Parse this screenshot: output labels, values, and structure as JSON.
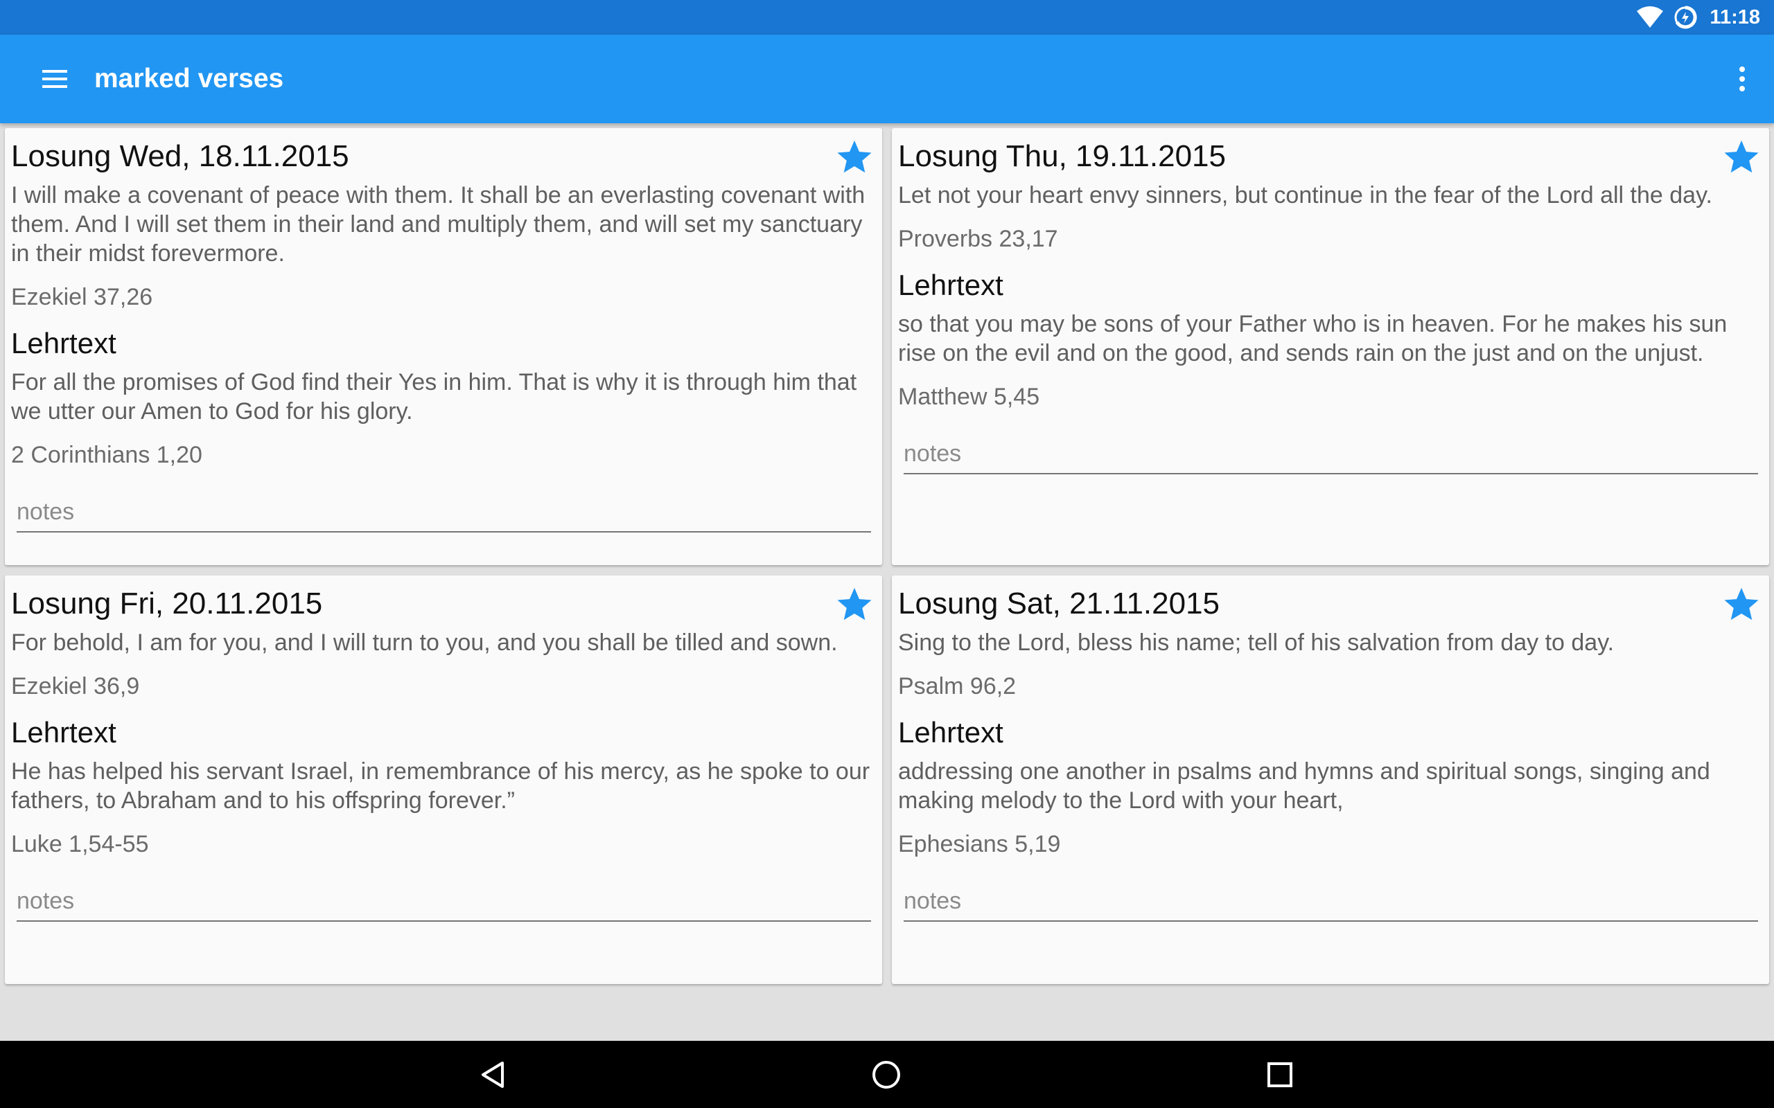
{
  "status_bar": {
    "time": "11:18",
    "wifi_icon": "wifi-icon",
    "battery_icon": "battery-charging-icon",
    "colors": {
      "background": "#1976d2"
    }
  },
  "app_bar": {
    "title": "marked verses",
    "menu_icon": "hamburger-menu-icon",
    "overflow_icon": "more-vertical-icon",
    "colors": {
      "background": "#2196f3",
      "accent": "#2196f3"
    }
  },
  "cards": [
    {
      "title": "Losung Wed, 18.11.2015",
      "starred": true,
      "losung_text": "I will make a covenant of peace with them. It shall be an everlasting covenant with them. And I will set them in their land and multiply them, and will set my sanctuary in their midst forevermore.",
      "losung_ref": "Ezekiel 37,26",
      "lehrtext_heading": "Lehrtext",
      "lehrtext_text": "For all the promises of God find their Yes in him. That is why it is through him that we utter our Amen to God for his glory.",
      "lehrtext_ref": "2 Corinthians 1,20",
      "notes_placeholder": "notes",
      "notes_value": ""
    },
    {
      "title": "Losung Thu, 19.11.2015",
      "starred": true,
      "losung_text": "Let not your heart envy sinners, but continue in the fear of the Lord all the day.",
      "losung_ref": "Proverbs 23,17",
      "lehrtext_heading": "Lehrtext",
      "lehrtext_text": "so that you may be sons of your Father who is in heaven. For he makes his sun rise on the evil and on the good, and sends rain on the just and on the unjust.",
      "lehrtext_ref": "Matthew 5,45",
      "notes_placeholder": "notes",
      "notes_value": ""
    },
    {
      "title": "Losung Fri, 20.11.2015",
      "starred": true,
      "losung_text": "For behold, I am for you, and I will turn to you, and you shall be tilled and sown.",
      "losung_ref": "Ezekiel 36,9",
      "lehrtext_heading": "Lehrtext",
      "lehrtext_text": "He has helped his servant Israel, in remembrance of his mercy, as he spoke to our fathers, to Abraham and to his offspring forever.”",
      "lehrtext_ref": "Luke 1,54-55",
      "notes_placeholder": "notes",
      "notes_value": ""
    },
    {
      "title": "Losung Sat, 21.11.2015",
      "starred": true,
      "losung_text": "Sing to the Lord, bless his name; tell of his salvation from day to day.",
      "losung_ref": "Psalm 96,2",
      "lehrtext_heading": "Lehrtext",
      "lehrtext_text": "addressing one another in psalms and hymns and spiritual songs, singing and making melody to the Lord with your heart,",
      "lehrtext_ref": "Ephesians 5,19",
      "notes_placeholder": "notes",
      "notes_value": ""
    }
  ],
  "nav_bar": {
    "back_icon": "back-triangle-icon",
    "home_icon": "home-circle-icon",
    "recents_icon": "recents-square-icon"
  }
}
